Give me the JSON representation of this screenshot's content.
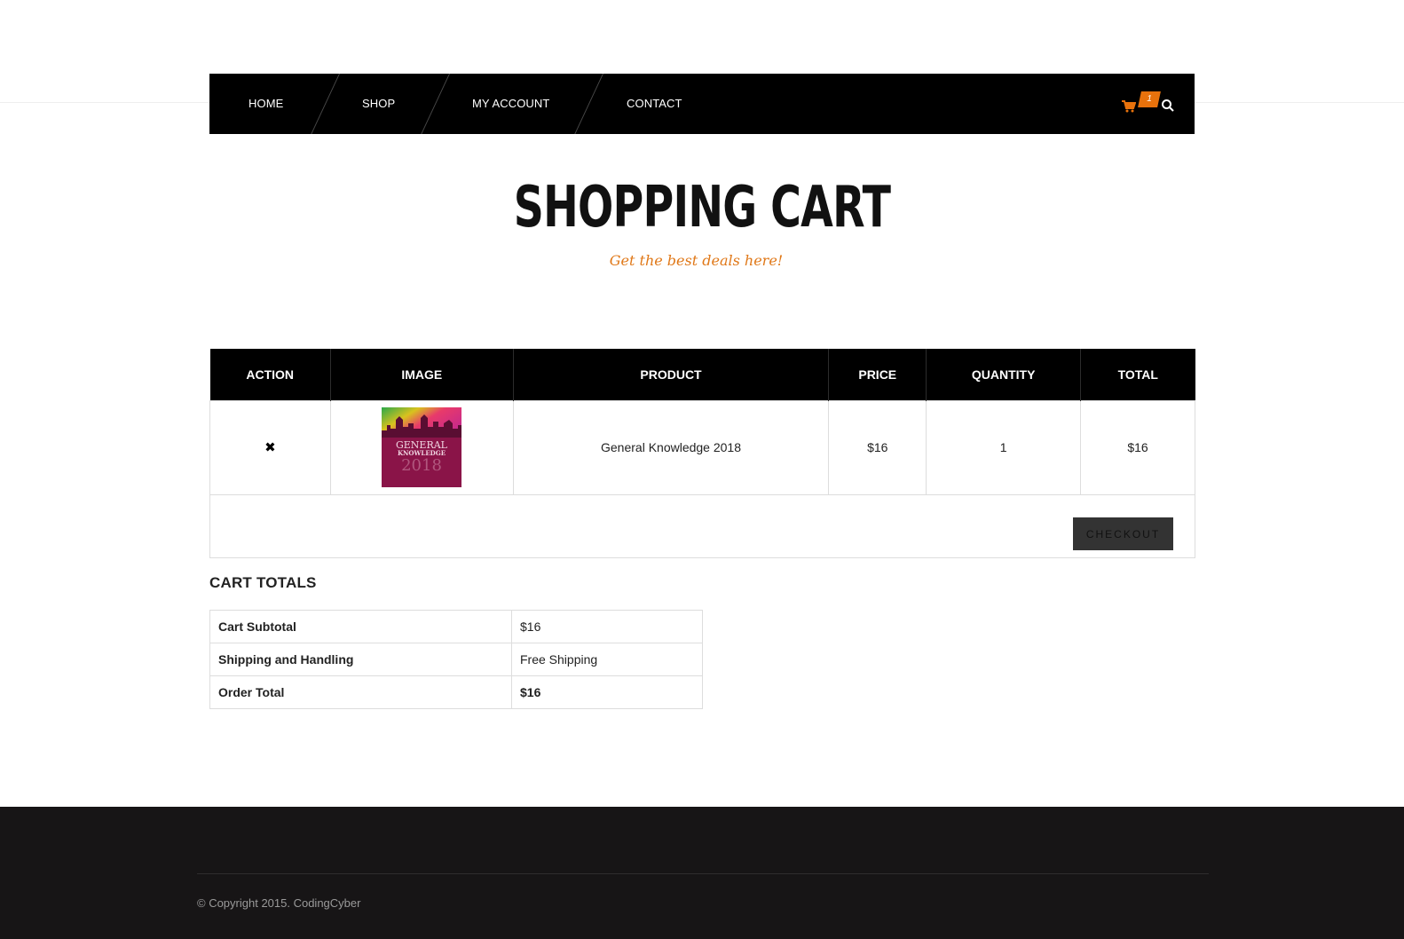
{
  "nav": {
    "home": "HOME",
    "shop": "SHOP",
    "account": "MY ACCOUNT",
    "contact": "CONTACT",
    "cart_count": "1",
    "cart_icon": "shopping-cart-icon",
    "search_icon": "magnifier-icon"
  },
  "hero": {
    "title": "SHOPPING CART",
    "subtitle": "Get the best deals here!"
  },
  "cart_table": {
    "headers": [
      "ACTION",
      "IMAGE",
      "PRODUCT",
      "PRICE",
      "QUANTITY",
      "TOTAL"
    ],
    "rows": [
      {
        "action": "✖",
        "image_text_1": "GENERAL",
        "image_text_2": "KNOWLEDGE",
        "image_text_3": "2018",
        "product": "General Knowledge 2018",
        "price": "$16",
        "quantity": "1",
        "total": "$16"
      }
    ],
    "checkout_label": "CHECKOUT"
  },
  "totals": {
    "heading": "CART TOTALS",
    "rows": [
      {
        "label": "Cart Subtotal",
        "value": "$16"
      },
      {
        "label": "Shipping and Handling",
        "value": "Free Shipping"
      },
      {
        "label": "Order Total",
        "value": "$16"
      }
    ]
  },
  "footer": {
    "copyright": "© Copyright 2015. CodingCyber"
  },
  "colors": {
    "accent": "#e8720c",
    "nav_bg": "#000000",
    "footer_bg": "#171516",
    "checkout_bg": "#333333"
  }
}
